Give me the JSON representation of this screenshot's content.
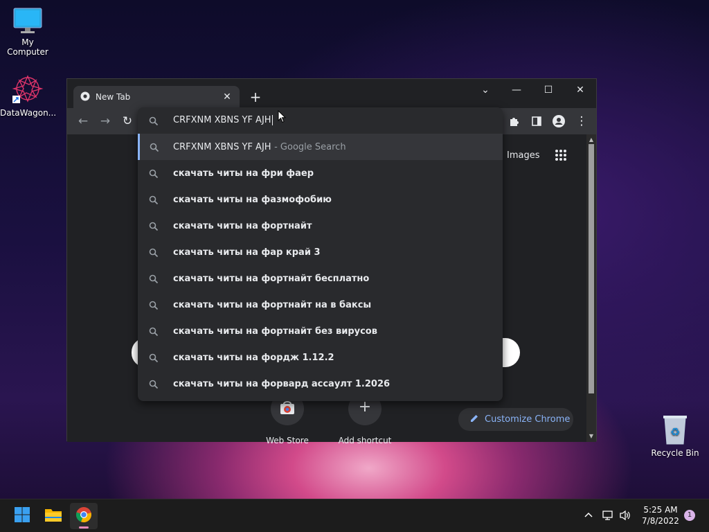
{
  "desktop": {
    "icons": [
      {
        "label": "My Computer",
        "icon": "monitor-icon"
      },
      {
        "label": "DataWagon...",
        "icon": "datawagon-shortcut-icon"
      },
      {
        "label": "Recycle Bin",
        "icon": "recycle-bin-icon"
      }
    ]
  },
  "browser": {
    "tab_title": "New Tab",
    "tab_close": "✕",
    "new_tab": "+",
    "window_controls": {
      "dropdown": "⌄",
      "minimize": "—",
      "maximize": "☐",
      "close": "✕"
    },
    "omnibox": {
      "query": "CRFXNM XBNS YF AJH",
      "first_suggestion": {
        "text": "CRFXNM XBNS YF AJH",
        "hint": "- Google Search"
      },
      "suggestions": [
        "скачать читы на фри фаер",
        "скачать читы на фазмофобию",
        "скачать читы на фортнайт",
        "скачать читы на фар край 3",
        "скачать читы на фортнайт бесплатно",
        "скачать читы на фортнайт на в баксы",
        "скачать читы на фортнайт без вирусов",
        "скачать читы на фордж 1.12.2",
        "скачать читы на форвард ассаулт 1.2026"
      ]
    },
    "ntp": {
      "images_link": "Images",
      "tiles": [
        "Web Store",
        "Add shortcut"
      ],
      "customize": "Customize Chrome"
    }
  },
  "taskbar": {
    "time": "5:25 AM",
    "date": "7/8/2022",
    "notification_count": "1"
  },
  "colors": {
    "accent": "#8ab4f8",
    "chrome_bg": "#202124",
    "taskbar": "#1c1c1c"
  }
}
